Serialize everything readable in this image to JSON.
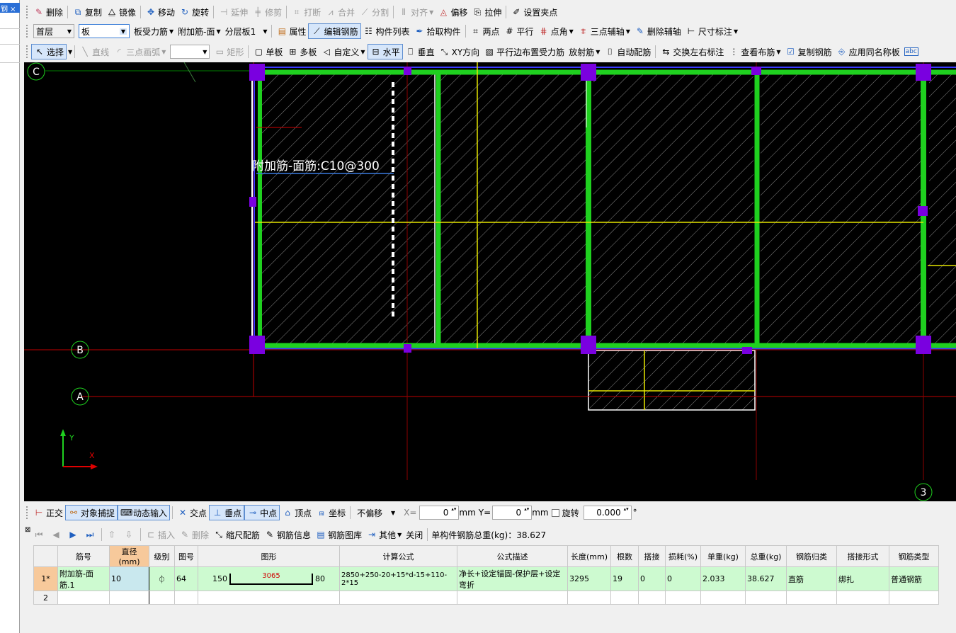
{
  "left_panel": {
    "tab_label": "钢 ×"
  },
  "toolbar1": {
    "delete": "删除",
    "copy": "复制",
    "mirror": "镜像",
    "move": "移动",
    "rotate": "旋转",
    "extend": "延伸",
    "trim": "修剪",
    "break": "打断",
    "merge": "合并",
    "split": "分割",
    "align": "对齐",
    "offset": "偏移",
    "stretch": "拉伸",
    "set_grip": "设置夹点"
  },
  "toolbar2": {
    "floor": "首层",
    "component_type": "板",
    "category": "板受力筋",
    "rebar_name": "附加筋-面",
    "layer": "分层板1",
    "properties": "属性",
    "edit_rebar": "编辑钢筋",
    "component_list": "构件列表",
    "pick_component": "拾取构件",
    "two_points": "两点",
    "parallel": "平行",
    "point_angle": "点角",
    "three_point_axis": "三点辅轴",
    "delete_axis": "删除辅轴",
    "dimension": "尺寸标注"
  },
  "toolbar3": {
    "select": "选择",
    "line": "直线",
    "arc": "三点画弧",
    "rect": "矩形",
    "single_slab": "单板",
    "multi_slab": "多板",
    "custom": "自定义",
    "horizontal": "水平",
    "vertical": "垂直",
    "xy_direction": "XY方向",
    "parallel_edge": "平行边布置受力筋",
    "radial": "放射筋",
    "auto_rebar": "自动配筋",
    "swap_labels": "交换左右标注",
    "view_rebar": "查看布筋",
    "copy_rebar": "复制钢筋",
    "apply_same": "应用同名称板",
    "abc": "abc"
  },
  "canvas": {
    "rebar_label": "附加筋-面筋:C10@300",
    "axis_labels": {
      "c": "C",
      "b": "B",
      "a": "A",
      "three": "3"
    },
    "ucs": {
      "y": "Y",
      "x": "X"
    }
  },
  "statusbar": {
    "ortho": "正交",
    "snap": "对象捕捉",
    "dynamic_input": "动态输入",
    "intersection": "交点",
    "perpendicular": "垂点",
    "midpoint": "中点",
    "vertex": "顶点",
    "coordinate": "坐标",
    "offset_mode": "不偏移",
    "x_label": "X=",
    "x_value": "0",
    "y_label": "Y=",
    "y_value": "0",
    "unit": "mm",
    "rotate_label": "旋转",
    "rotate_value": "0.000",
    "degree": "°"
  },
  "rebar_toolbar": {
    "insert": "插入",
    "delete": "删除",
    "scale_rebar": "缩尺配筋",
    "rebar_info": "钢筋信息",
    "rebar_library": "钢筋图库",
    "other": "其他",
    "close": "关闭",
    "total_weight": "单构件钢筋总重(kg)：38.627"
  },
  "table": {
    "headers": [
      "筋号",
      "直径(mm)",
      "级别",
      "图号",
      "图形",
      "计算公式",
      "公式描述",
      "长度(mm)",
      "根数",
      "搭接",
      "损耗(%)",
      "单重(kg)",
      "总重(kg)",
      "钢筋归类",
      "搭接形式",
      "钢筋类型"
    ],
    "rows": [
      {
        "rownum": "1*",
        "name": "附加筋-面筋.1",
        "diameter": "10",
        "grade": "⏀",
        "figure_no": "64",
        "shape_left": "150",
        "shape_mid": "3065",
        "shape_right": "80",
        "formula": "2850+250-20+15*d-15+110-2*15",
        "description": "净长+设定锚固-保护层+设定弯折",
        "length": "3295",
        "count": "19",
        "lap": "0",
        "loss": "0",
        "unit_weight": "2.033",
        "total_weight": "38.627",
        "category": "直筋",
        "lap_type": "绑扎",
        "rebar_type": "普通钢筋"
      },
      {
        "rownum": "2"
      }
    ]
  },
  "colors": {
    "canvas_bg": "#000000",
    "beam_green": "#1fd01f",
    "column_purple": "#7a00e0",
    "axis_red": "#c00000",
    "yellow_line": "#e6e600"
  }
}
